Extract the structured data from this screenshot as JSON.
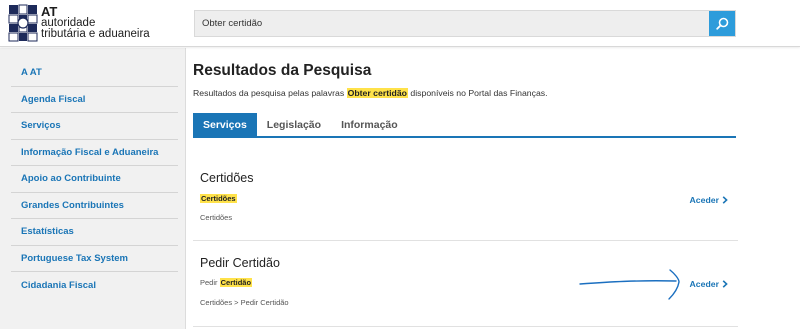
{
  "header": {
    "logo": {
      "brand": "AT",
      "line1": "autoridade",
      "line2": "tributária e aduaneira"
    },
    "search": {
      "value": "Obter certidão",
      "icon": "search-icon"
    }
  },
  "sidebar": {
    "items": [
      {
        "label": "A AT"
      },
      {
        "label": "Agenda Fiscal"
      },
      {
        "label": "Serviços"
      },
      {
        "label": "Informação Fiscal e Aduaneira"
      },
      {
        "label": "Apoio ao Contribuinte"
      },
      {
        "label": "Grandes Contribuintes"
      },
      {
        "label": "Estatísticas"
      },
      {
        "label": "Portuguese Tax System"
      },
      {
        "label": "Cidadania Fiscal"
      }
    ]
  },
  "main": {
    "title": "Resultados da Pesquisa",
    "lead": {
      "before": "Resultados da pesquisa pelas palavras",
      "term": "Obter certidão",
      "after": "disponíveis no Portal das Finanças."
    },
    "tabs": [
      {
        "label": "Serviços",
        "active": true
      },
      {
        "label": "Legislação",
        "active": false
      },
      {
        "label": "Informação",
        "active": false
      }
    ],
    "results": [
      {
        "title": "Certidões",
        "snippet_before": "",
        "snippet_highlight": "Certidões",
        "path": "Certidões",
        "action": "Aceder"
      },
      {
        "title": "Pedir Certidão",
        "snippet_before": "Pedir",
        "snippet_highlight": "Certidão",
        "path": "Certidões > Pedir Certidão",
        "action": "Aceder"
      }
    ]
  },
  "colors": {
    "accent": "#1a75b6",
    "search_button": "#2d9cdb",
    "highlight": "#ffe24a",
    "sidebar_bg": "#f1f1f1"
  }
}
